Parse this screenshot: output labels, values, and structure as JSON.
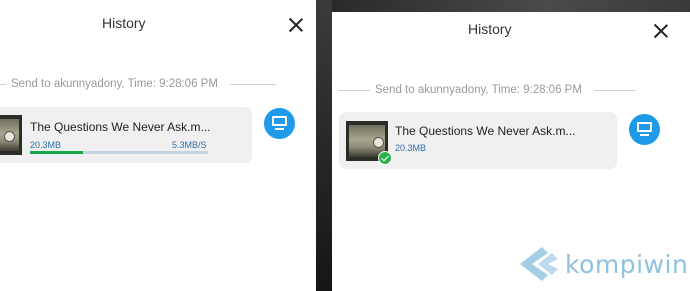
{
  "left_window": {
    "title": "History",
    "meta": "Send to akunnyadony, Time: 9:28:06 PM",
    "file": {
      "name": "The Questions We Never Ask.m...",
      "size": "20.3MB",
      "speed": "5.3MB/S",
      "progress": 0.3
    }
  },
  "right_window": {
    "title": "History",
    "meta": "Send to akunnyadony, Time: 9:28:06 PM",
    "file": {
      "name": "The Questions We Never Ask.m...",
      "size": "20.3MB"
    }
  },
  "watermark": {
    "text": "kompiwin"
  },
  "colors": {
    "accent_blue": "#1e9ae8",
    "progress_green": "#1aa64a",
    "success_green": "#2bb24c"
  }
}
